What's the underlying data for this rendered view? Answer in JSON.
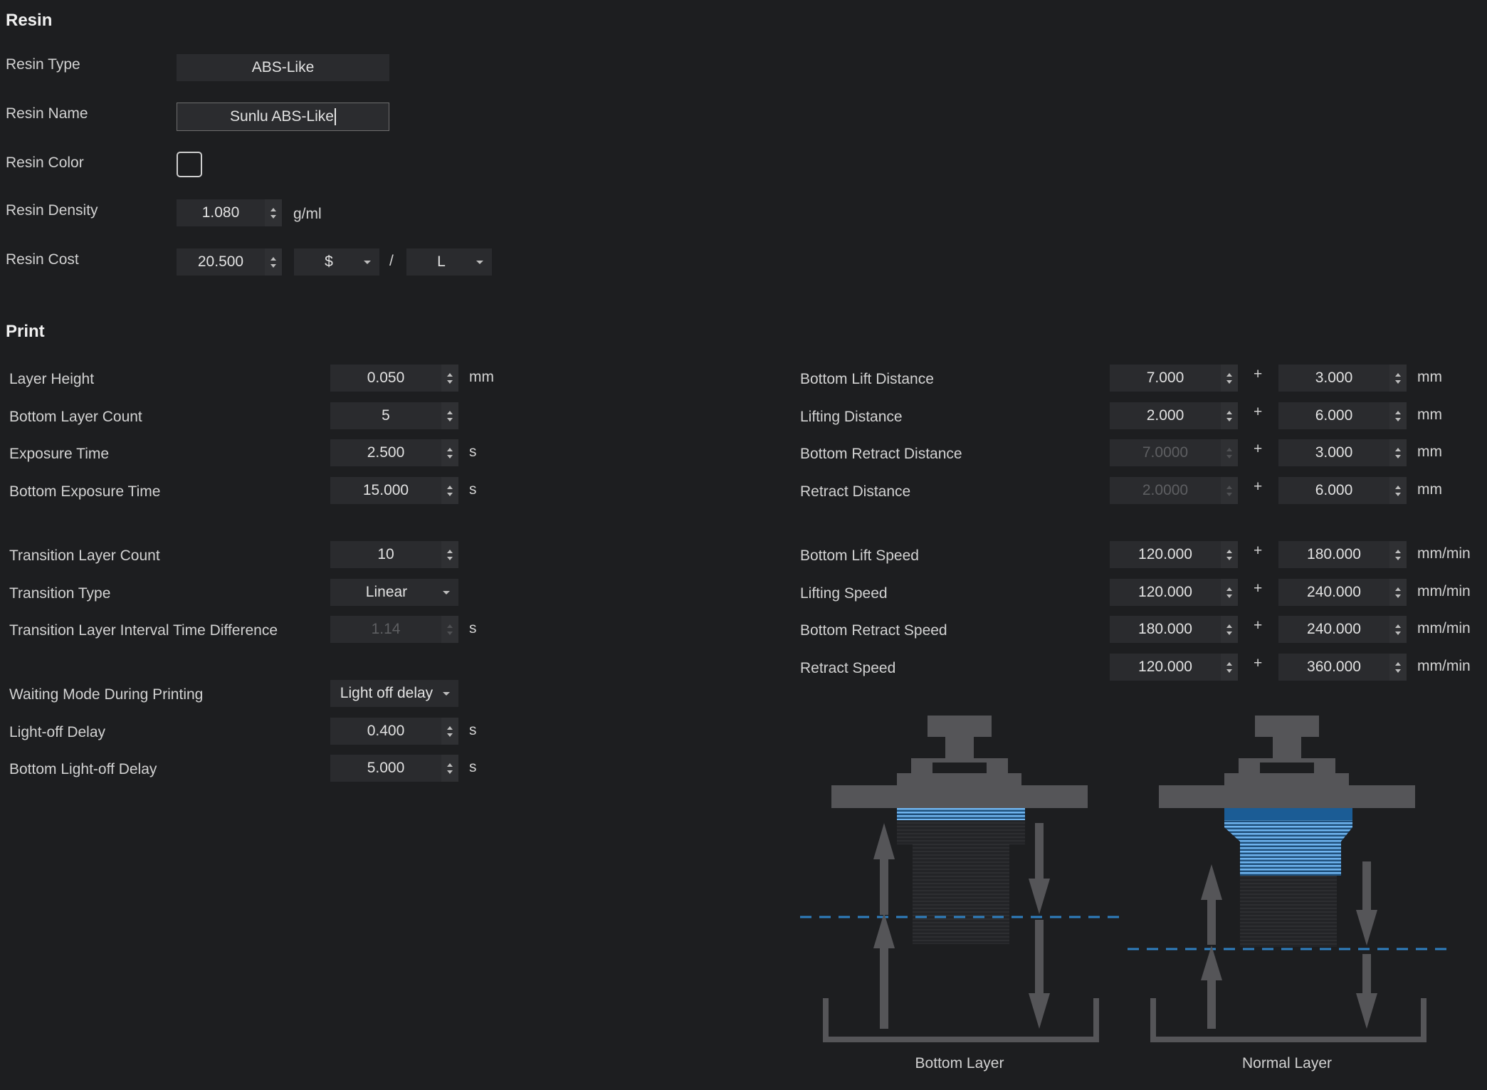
{
  "resin": {
    "title": "Resin",
    "type_label": "Resin Type",
    "type_value": "ABS-Like",
    "name_label": "Resin Name",
    "name_value": "Sunlu ABS-Like",
    "color_label": "Resin Color",
    "density_label": "Resin Density",
    "density_value": "1.080",
    "density_unit": "g/ml",
    "cost_label": "Resin Cost",
    "cost_value": "20.500",
    "cost_currency": "$",
    "cost_separator": "/",
    "cost_volume_unit": "L"
  },
  "print": {
    "title": "Print",
    "left": [
      {
        "label": "Layer Height",
        "value": "0.050",
        "unit": "mm",
        "kind": "spin"
      },
      {
        "label": "Bottom Layer Count",
        "value": "5",
        "unit": "",
        "kind": "spin"
      },
      {
        "label": "Exposure Time",
        "value": "2.500",
        "unit": "s",
        "kind": "spin"
      },
      {
        "label": "Bottom Exposure Time",
        "value": "15.000",
        "unit": "s",
        "kind": "spin"
      },
      {
        "label": "Transition Layer Count",
        "value": "10",
        "unit": "",
        "kind": "spin"
      },
      {
        "label": "Transition Type",
        "value": "Linear",
        "unit": "",
        "kind": "dropdown"
      },
      {
        "label": "Transition Layer Interval Time Difference",
        "value": "1.14",
        "unit": "s",
        "kind": "spin-disabled"
      },
      {
        "label": "Waiting Mode During Printing",
        "value": "Light off delay",
        "unit": "",
        "kind": "dropdown"
      },
      {
        "label": "Light-off Delay",
        "value": "0.400",
        "unit": "s",
        "kind": "spin"
      },
      {
        "label": "Bottom Light-off Delay",
        "value": "5.000",
        "unit": "s",
        "kind": "spin"
      }
    ],
    "right": [
      {
        "label": "Bottom Lift Distance",
        "value1": "7.000",
        "value2": "3.000",
        "unit": "mm",
        "disabled1": false
      },
      {
        "label": "Lifting Distance",
        "value1": "2.000",
        "value2": "6.000",
        "unit": "mm",
        "disabled1": false
      },
      {
        "label": "Bottom Retract Distance",
        "value1": "7.0000",
        "value2": "3.000",
        "unit": "mm",
        "disabled1": true
      },
      {
        "label": "Retract Distance",
        "value1": "2.0000",
        "value2": "6.000",
        "unit": "mm",
        "disabled1": true
      },
      {
        "label": "Bottom Lift Speed",
        "value1": "120.000",
        "value2": "180.000",
        "unit": "mm/min",
        "disabled1": false
      },
      {
        "label": "Lifting Speed",
        "value1": "120.000",
        "value2": "240.000",
        "unit": "mm/min",
        "disabled1": false
      },
      {
        "label": "Bottom Retract Speed",
        "value1": "180.000",
        "value2": "240.000",
        "unit": "mm/min",
        "disabled1": false
      },
      {
        "label": "Retract Speed",
        "value1": "120.000",
        "value2": "360.000",
        "unit": "mm/min",
        "disabled1": false
      }
    ],
    "plus_sign": "+"
  },
  "diagrams": {
    "bottom_caption": "Bottom Layer",
    "normal_caption": "Normal Layer",
    "platform_color": "#555558",
    "layer_blue": "#4f9fe0",
    "layer_dark_blue": "#1b5c95",
    "dash_color": "#2f7fbf"
  }
}
